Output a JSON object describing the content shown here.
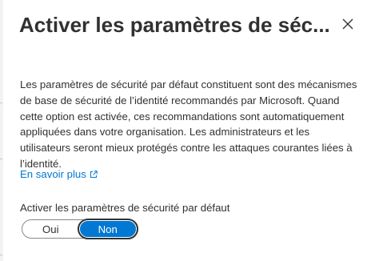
{
  "panel": {
    "title": "Activer les paramètres de séc...",
    "close_icon": "close-icon",
    "description": "Les paramètres de sécurité par défaut constituent sont des mécanismes de base de sécurité de l’identité recommandés par Microsoft. Quand cette option est activée, ces recommandations sont automatiquement appliquées dans votre organisation. Les administrateurs et les utilisateurs seront mieux protégés contre les attaques courantes liées à l’identité.",
    "learn_more_label": "En savoir plus",
    "learn_more_icon": "external-link-icon",
    "toggle": {
      "label": "Activer les paramètres de sécurité par défaut",
      "options": [
        "Oui",
        "Non"
      ],
      "selected": "Non"
    }
  },
  "colors": {
    "accent": "#0078d4",
    "text": "#323130",
    "border": "#8a8886"
  }
}
